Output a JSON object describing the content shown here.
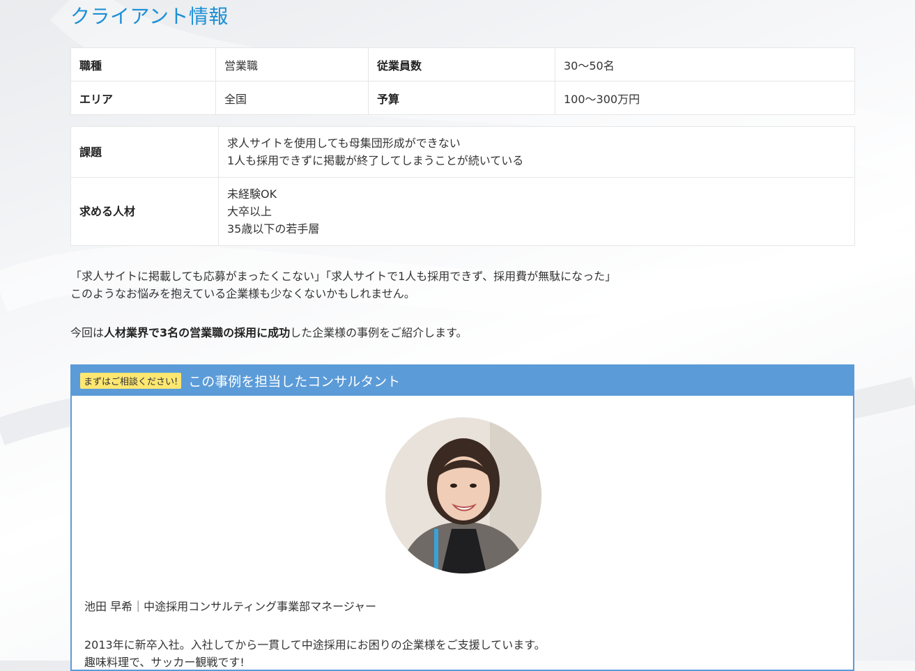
{
  "page_title": "クライアント情報",
  "summary_table": {
    "row1": {
      "label1": "職種",
      "value1": "営業職",
      "label2": "従業員数",
      "value2": "30〜50名"
    },
    "row2": {
      "label1": "エリア",
      "value1": "全国",
      "label2": "予算",
      "value2": "100〜300万円"
    }
  },
  "details_table": {
    "issue_label": "課題",
    "issue_lines": [
      "求人サイトを使用しても母集団形成ができない",
      "1人も採用できずに掲載が終了してしまうことが続いている"
    ],
    "talent_label": "求める人材",
    "talent_lines": [
      "未経験OK",
      "大卒以上",
      "35歳以下の若手層"
    ]
  },
  "intro": {
    "line1": "「求人サイトに掲載しても応募がまったくこない」「求人サイトで1人も採用できず、採用費が無駄になった」",
    "line2": "このようなお悩みを抱えている企業様も少なくないかもしれません。",
    "line3_pre": "今回は",
    "line3_bold": "人材業界で3名の営業職の採用に成功",
    "line3_post": "した企業様の事例をご紹介します。"
  },
  "consultant_box": {
    "badge": "まずはご相談ください!",
    "title": "この事例を担当したコンサルタント",
    "name_line": "池田 早希｜中途採用コンサルティング事業部マネージャー",
    "bio_line1": "2013年に新卒入社。入社してから一貫して中途採用にお困りの企業様をご支援しています。",
    "bio_line2": "趣味料理で、サッカー観戦です!"
  },
  "colors": {
    "title_blue": "#1c8fd6",
    "box_blue": "#5b9bd8",
    "badge_yellow": "#fde771"
  }
}
